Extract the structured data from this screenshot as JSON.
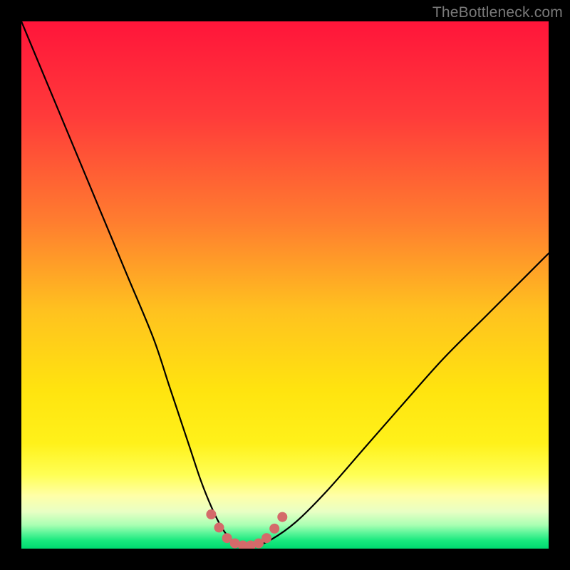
{
  "watermark": "TheBottleneck.com",
  "colors": {
    "gradient_stops": [
      {
        "offset": 0.0,
        "color": "#ff153a"
      },
      {
        "offset": 0.18,
        "color": "#ff3b3a"
      },
      {
        "offset": 0.38,
        "color": "#ff7d2f"
      },
      {
        "offset": 0.55,
        "color": "#ffc21f"
      },
      {
        "offset": 0.7,
        "color": "#ffe40f"
      },
      {
        "offset": 0.8,
        "color": "#fff11a"
      },
      {
        "offset": 0.86,
        "color": "#ffff55"
      },
      {
        "offset": 0.9,
        "color": "#ffffa8"
      },
      {
        "offset": 0.93,
        "color": "#e8ffc4"
      },
      {
        "offset": 0.955,
        "color": "#aaffb3"
      },
      {
        "offset": 0.97,
        "color": "#5df59a"
      },
      {
        "offset": 0.985,
        "color": "#17e87d"
      },
      {
        "offset": 1.0,
        "color": "#00d970"
      }
    ],
    "curve": "#000000",
    "dots": "#d46a6a",
    "frame_bg": "#000000"
  },
  "chart_data": {
    "type": "line",
    "title": "",
    "xlabel": "",
    "ylabel": "",
    "xlim": [
      0,
      100
    ],
    "ylim": [
      0,
      100
    ],
    "grid": false,
    "series": [
      {
        "name": "bottleneck-curve",
        "x": [
          0,
          5,
          10,
          15,
          20,
          25,
          28,
          30,
          32,
          34,
          36,
          38,
          40,
          42,
          44,
          47,
          52,
          58,
          65,
          72,
          80,
          88,
          94,
          100
        ],
        "values": [
          100,
          88,
          76,
          64,
          52,
          40,
          31,
          25,
          19,
          13,
          8,
          4,
          1.5,
          0.5,
          0.5,
          1.5,
          5,
          11,
          19,
          27,
          36,
          44,
          50,
          56
        ]
      }
    ],
    "dots": {
      "name": "trough-markers",
      "x": [
        36,
        37.5,
        39,
        40.5,
        42,
        43.5,
        45,
        46.5,
        48,
        49.5
      ],
      "values": [
        6.5,
        4.0,
        2.0,
        1.0,
        0.6,
        0.6,
        1.0,
        2.0,
        3.8,
        6.0
      ],
      "radius": 7
    }
  }
}
